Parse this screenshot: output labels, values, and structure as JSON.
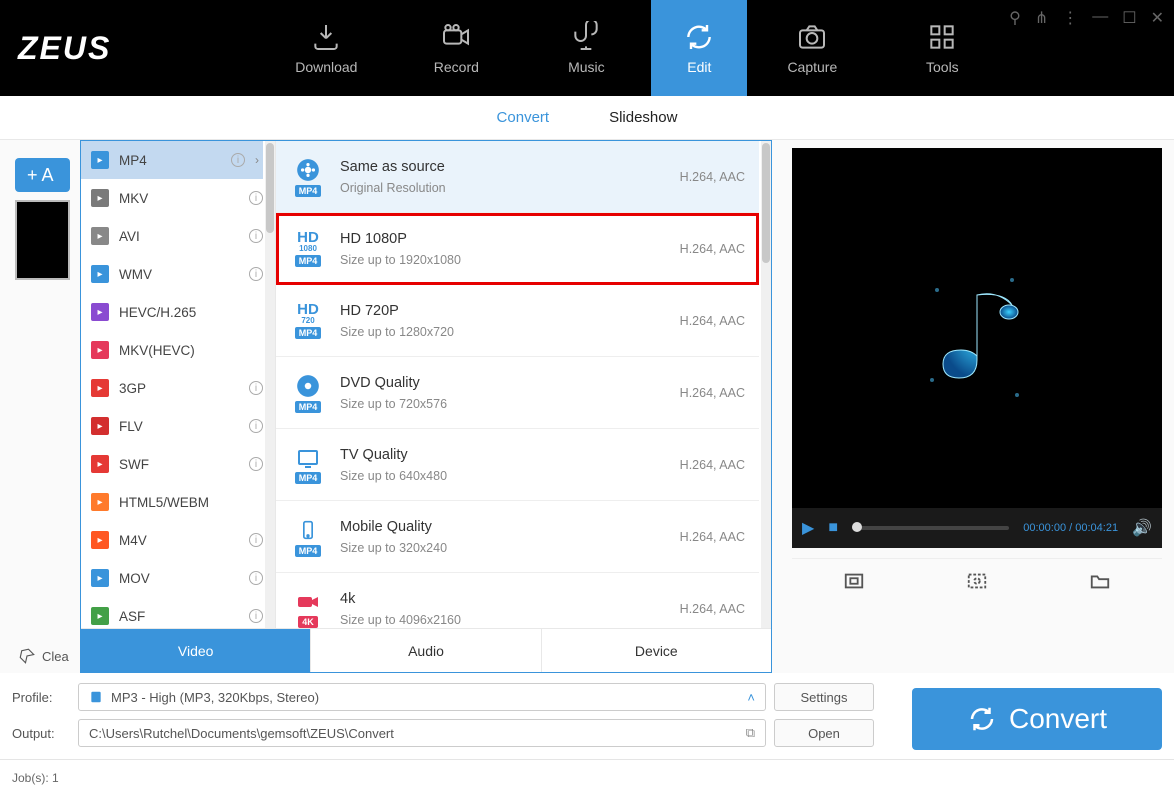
{
  "logo": "ZEUS",
  "topnav": [
    "Download",
    "Record",
    "Music",
    "Edit",
    "Capture",
    "Tools"
  ],
  "subnav": {
    "convert": "Convert",
    "slideshow": "Slideshow"
  },
  "add_label": "+ A",
  "formats": [
    {
      "label": "MP4",
      "cls": "ic-mp4",
      "sel": true,
      "chev": true
    },
    {
      "label": "MKV",
      "cls": "ic-mkv"
    },
    {
      "label": "AVI",
      "cls": "ic-avi"
    },
    {
      "label": "WMV",
      "cls": "ic-wmv"
    },
    {
      "label": "HEVC/H.265",
      "cls": "ic-hevc"
    },
    {
      "label": "MKV(HEVC)",
      "cls": "ic-mkvh"
    },
    {
      "label": "3GP",
      "cls": "ic-3gp"
    },
    {
      "label": "FLV",
      "cls": "ic-flv"
    },
    {
      "label": "SWF",
      "cls": "ic-swf"
    },
    {
      "label": "HTML5/WEBM",
      "cls": "ic-webm"
    },
    {
      "label": "M4V",
      "cls": "ic-m4v"
    },
    {
      "label": "MOV",
      "cls": "ic-mov"
    },
    {
      "label": "ASF",
      "cls": "ic-asf"
    }
  ],
  "qualities": [
    {
      "title": "Same as source",
      "sub": "Original Resolution",
      "codec": "H.264, AAC",
      "badge": "MP4",
      "first": true,
      "icon": "film"
    },
    {
      "title": "HD 1080P",
      "sub": "Size up to 1920x1080",
      "codec": "H.264, AAC",
      "badge": "MP4",
      "hl": true,
      "icon": "hd",
      "res": "1080"
    },
    {
      "title": "HD 720P",
      "sub": "Size up to 1280x720",
      "codec": "H.264, AAC",
      "badge": "MP4",
      "icon": "hd",
      "res": "720"
    },
    {
      "title": "DVD Quality",
      "sub": "Size up to 720x576",
      "codec": "H.264, AAC",
      "badge": "MP4",
      "icon": "disc"
    },
    {
      "title": "TV Quality",
      "sub": "Size up to 640x480",
      "codec": "H.264, AAC",
      "badge": "MP4",
      "icon": "tv"
    },
    {
      "title": "Mobile Quality",
      "sub": "Size up to 320x240",
      "codec": "H.264, AAC",
      "badge": "MP4",
      "icon": "mobile"
    },
    {
      "title": "4k",
      "sub": "Size up to 4096x2160",
      "codec": "H.264, AAC",
      "badge": "4K",
      "icon": "cam",
      "k4": true
    }
  ],
  "dd_tabs": [
    "Video",
    "Audio",
    "Device"
  ],
  "preview": {
    "time": "00:00:00 / 00:04:21"
  },
  "clear": "Clea",
  "profile_label": "Profile:",
  "profile_value": "MP3 - High (MP3, 320Kbps, Stereo)",
  "output_label": "Output:",
  "output_value": "C:\\Users\\Rutchel\\Documents\\gemsoft\\ZEUS\\Convert",
  "settings": "Settings",
  "open": "Open",
  "convert": "Convert",
  "jobs": "Job(s): 1"
}
